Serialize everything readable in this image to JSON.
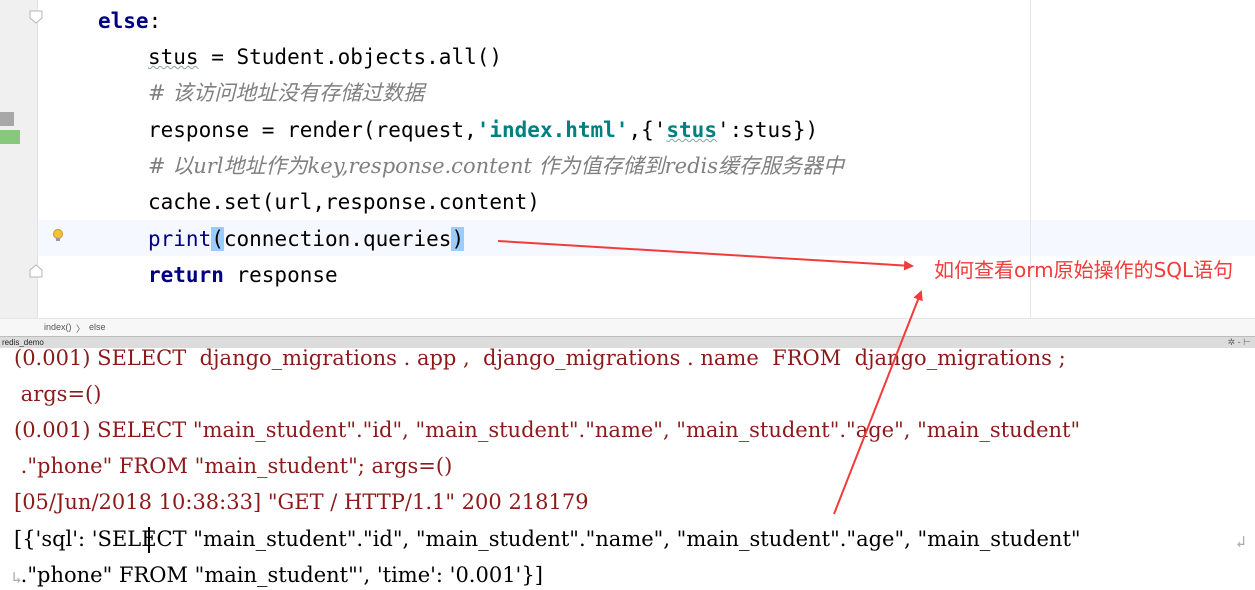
{
  "editor": {
    "lines": [
      {
        "kw": "else",
        "rest": ":"
      },
      {
        "var": "stus",
        "rest": " = Student.objects.all()"
      },
      {
        "comment": "# 该访问地址没有存储过数据"
      },
      {
        "pre": "response = render(request,",
        "str1": "'index.html'",
        "mid": ",{'",
        "str2": "stus",
        "post": "':stus})"
      },
      {
        "comment": "# 以url地址作为key,response.content 作为值存储到redis缓存服务器中"
      },
      {
        "text": "cache.set(url,response.content)"
      },
      {
        "builtin": "print",
        "open": "(",
        "body": "connection.queries",
        "close": ")"
      },
      {
        "kw": "return",
        "rest": " response"
      }
    ]
  },
  "breadcrumb": {
    "func": "index()",
    "sep": "〉",
    "block": "else"
  },
  "run_panel": {
    "tab_label": "redis_demo",
    "tools": "✲ - ⊢"
  },
  "console": {
    "lines": [
      "(0.001) SELECT  django_migrations . app ,  django_migrations . name  FROM  django_migrations ;",
      " args=()",
      "(0.001) SELECT \"main_student\".\"id\", \"main_student\".\"name\", \"main_student\".\"age\", \"main_student\"",
      " .\"phone\" FROM \"main_student\"; args=()",
      "[05/Jun/2018 10:38:33] \"GET / HTTP/1.1\" 200 218179",
      "[{'sql': 'SELECT \"main_student\".\"id\", \"main_student\".\"name\", \"main_student\".\"age\", \"main_student\"",
      " .\"phone\" FROM \"main_student\"', 'time': '0.001'}]"
    ],
    "wrap_icon": "↲",
    "wrap_cont_icon": "↳"
  },
  "annotation": {
    "text": "如何查看orm原始操作的SQL语句"
  },
  "colors": {
    "annotation": "#f23b3b",
    "keyword": "#000080",
    "string": "#008080",
    "comment": "#808080",
    "console_sql": "#8b1a1a"
  }
}
